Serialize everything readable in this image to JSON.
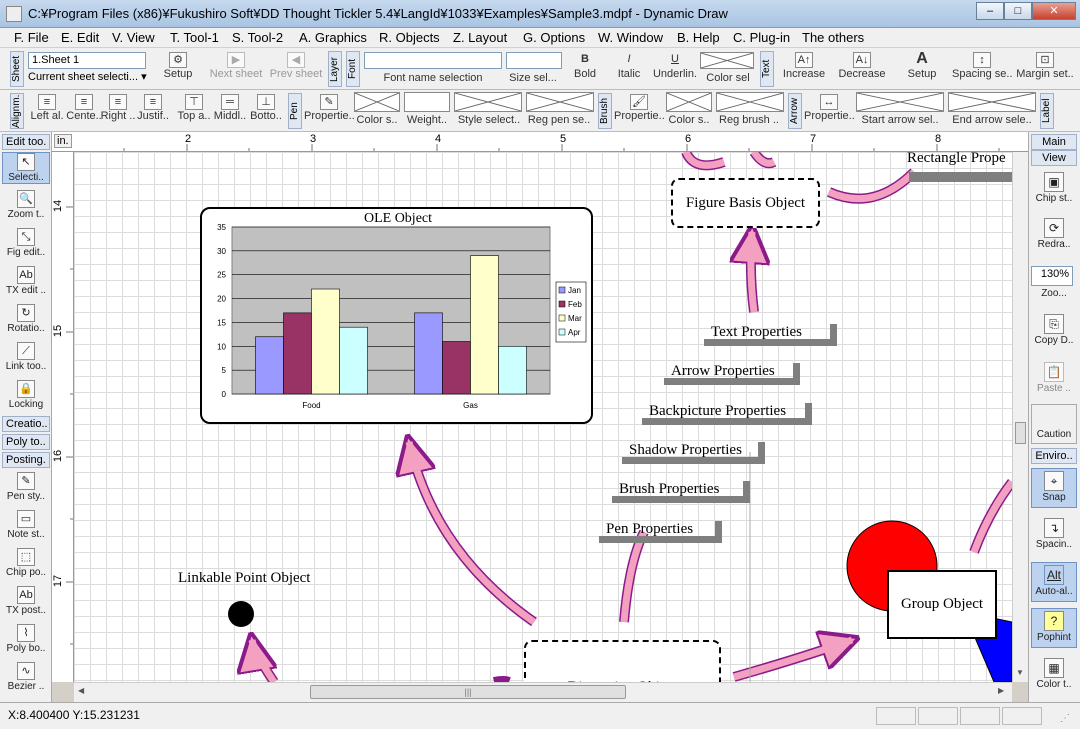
{
  "window": {
    "title": "C:¥Program Files (x86)¥Fukushiro Soft¥DD Thought Tickler 5.4¥LangId¥1033¥Examples¥Sample3.mdpf - Dynamic Draw",
    "btn_min": "–",
    "btn_max": "□",
    "btn_close": "✕"
  },
  "menu": [
    "F. File",
    "E. Edit",
    "V. View",
    "T. Tool-1",
    "S. Tool-2",
    "A. Graphics",
    "R. Objects",
    "Z. Layout",
    "G. Options",
    "W. Window",
    "B. Help",
    "C. Plug-in",
    "The others"
  ],
  "toolbar1": {
    "sheet_label": "Sheet",
    "sheet_value": "1.Sheet 1",
    "current_sheet": "Current sheet selecti...",
    "setup": "Setup",
    "next_sheet": "Next sheet",
    "prev_sheet": "Prev sheet",
    "layer_label": "Layer",
    "font_label": "Font",
    "font_name": "Font name selection",
    "size_sel": "Size sel...",
    "bold": "Bold",
    "italic": "Italic",
    "underline": "Underlin.",
    "color_sel": "Color sel",
    "text_label": "Text",
    "increase": "Increase",
    "decrease": "Decrease",
    "text_setup": "Setup",
    "spacing": "Spacing se..",
    "margin": "Margin set.."
  },
  "toolbar2": {
    "align_label": "Alignm.",
    "left_al": "Left al.",
    "center": "Cente..",
    "right": "Right ..",
    "justify": "Justif..",
    "top_a": "Top a..",
    "middle": "Middl..",
    "bottom": "Botto..",
    "pen_label": "Pen",
    "pen_prop": "Propertie..",
    "pen_color": "Color s..",
    "weight": "Weight..",
    "style_sel": "Style select..",
    "reg_pen": "Reg pen se..",
    "brush_label": "Brush",
    "brush_prop": "Propertie..",
    "brush_color": "Color s..",
    "reg_brush": "Reg brush ..",
    "arrow_label": "Arrow",
    "arrow_prop": "Propertie..",
    "start_arrow": "Start arrow sel..",
    "end_arrow": "End arrow sele..",
    "label_label": "Label"
  },
  "left_panel": {
    "edit_tools": "Edit too.",
    "in_label": "in.",
    "tools": [
      "Selecti..",
      "Zoom t..",
      "Fig edit..",
      "TX edit ..",
      "Rotatio..",
      "Link too..",
      "Locking"
    ],
    "creation": "Creatio..",
    "poly_to": "Poly to..",
    "posting": "Posting.",
    "posting_tools": [
      "Pen sty..",
      "Note st..",
      "Chip po..",
      "TX post..",
      "Poly bo..",
      "Bezier .."
    ]
  },
  "right_panel": {
    "main": "Main",
    "view": "View",
    "chip_st": "Chip st..",
    "redraw": "Redra..",
    "zoom_value": "130%",
    "zoom": "Zoo...",
    "copy_d": "Copy D..",
    "paste": "Paste ..",
    "caution": "Caution",
    "environment": "Enviro..",
    "snap": "Snap",
    "spacing": "Spacin..",
    "auto_al": "Auto-al..",
    "auto_al_icon": "Alt",
    "pophint": "Pophint",
    "color_t": "Color t.."
  },
  "hruler": [
    "2",
    "3",
    "4",
    "5",
    "6",
    "7",
    "8"
  ],
  "vruler": [
    "14",
    "15",
    "16",
    "17"
  ],
  "canvas": {
    "rect_prop": "Rectangle Prope",
    "figure_basis": "Figure Basis Object",
    "text_prop": "Text Properties",
    "arrow_prop": "Arrow Properties",
    "backpicture_prop": "Backpicture Properties",
    "shadow_prop": "Shadow Properties",
    "brush_prop": "Brush Properties",
    "pen_prop": "Pen Properties",
    "ole_object": "OLE Object",
    "linkable_point": "Linkable Point Object",
    "group_object": "Group Object",
    "dimension_object": "Dimension Object"
  },
  "chart_data": {
    "type": "bar",
    "title": "OLE Object",
    "categories": [
      "Food",
      "Gas"
    ],
    "series": [
      {
        "name": "Jan",
        "values": [
          12,
          17
        ],
        "color": "#9999ff"
      },
      {
        "name": "Feb",
        "values": [
          17,
          11
        ],
        "color": "#993366"
      },
      {
        "name": "Mar",
        "values": [
          22,
          29
        ],
        "color": "#ffffcc"
      },
      {
        "name": "Apr",
        "values": [
          14,
          10
        ],
        "color": "#ccffff"
      }
    ],
    "ylim": [
      0,
      35
    ],
    "yticks": [
      "0",
      "5",
      "10",
      "15",
      "20",
      "25",
      "30",
      "35"
    ],
    "grid": true,
    "legend": "right",
    "plot_bg": "#c0c0c0"
  },
  "status": {
    "coords": "X:8.400400 Y:15.231231"
  }
}
